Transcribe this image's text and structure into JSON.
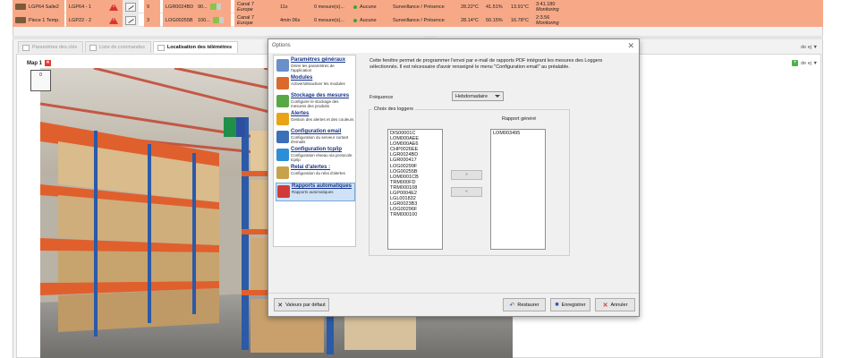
{
  "loggers_table": {
    "rows": [
      {
        "name": "LGP64 Salle2",
        "logger": "LGP64 - 1",
        "count": "9",
        "serial": "LGR0024BD",
        "signal": "90...",
        "channel": "Canal 7",
        "region": "Europe",
        "interval": "11s",
        "measures": "0 mesure(s)...",
        "alarm": "Aucune",
        "mode": "Surveillance / Présence",
        "v1": "28.22°C",
        "v2": "41.51%",
        "v3": "13.91°C",
        "time": "3:41.180",
        "status": "Monitoring"
      },
      {
        "name": "Piece 1 Temp.",
        "logger": "LGP22 - 2",
        "count": "3",
        "serial": "LOG00255B",
        "signal": "100...",
        "channel": "Canal 7",
        "region": "Europe",
        "interval": "4min 06s",
        "measures": "0 mesure(s)...",
        "alarm": "Aucune",
        "mode": "Surveillance / Présence",
        "v1": "28.14°C",
        "v2": "50.15%",
        "v3": "16.78°C",
        "time": "2:3.56",
        "status": "Monitoring"
      }
    ]
  },
  "tabs": [
    {
      "label": "Paramètres des clés",
      "active": false
    },
    {
      "label": "Liste de commandes",
      "active": false
    },
    {
      "label": "Localisation des télémètres",
      "active": true
    }
  ],
  "map": {
    "tab_label": "Map 1",
    "zoom_value": "0"
  },
  "right_controls": {
    "top": "de ej ▼",
    "bottom": "de ej ▼"
  },
  "dialog": {
    "title": "Options",
    "nav": [
      {
        "title": "Paramètres généraux",
        "desc": "Gérer les paramètres de l'application",
        "icon": "magnifier-icon",
        "color": "#6a8fc9"
      },
      {
        "title": "Modules",
        "desc": "Activer/désactiver les modules",
        "icon": "modules-icon",
        "color": "#d96a2b"
      },
      {
        "title": "Stockage des mesures",
        "desc": "Configurer le stockage des mesures des produits",
        "icon": "download-icon",
        "color": "#58a845"
      },
      {
        "title": "Alertes",
        "desc": "Gestion des alertes et des couleurs",
        "icon": "warning-icon",
        "color": "#e8a317"
      },
      {
        "title": "Configuration email",
        "desc": "Configuration du serveur sortant d'emails",
        "icon": "email-icon",
        "color": "#3b6fb6"
      },
      {
        "title": "Configuration tcp/ip",
        "desc": "Configuration réseau via protocole tcp/ip",
        "icon": "network-icon",
        "color": "#2c8ed6"
      },
      {
        "title": "Relai d'alertes :",
        "desc": "Configuration du relai d'alertes",
        "icon": "relay-icon",
        "color": "#c8a24a"
      },
      {
        "title": "Rapports automatiques",
        "desc": "Rapports automatiques",
        "icon": "report-icon",
        "color": "#d23a3a",
        "selected": true
      }
    ],
    "description": "Cette fenêtre permet de programmer l'envoi par e-mail de rapports PDF intégrant les mesures des Loggers sélectionnés. Il est nécessaire d'avoir renseigné le menu \"Configuration email\" au préalable.",
    "frequency_label": "Fréquence",
    "frequency_value": "Hebdomadaire",
    "loggers_group_label": "Choix des loggers",
    "generated_label": "Rapport généré",
    "loggers_list": [
      "DIS00001C",
      "LOM000AEE",
      "LOM000AE6",
      "CHP0026EE",
      "LGR0024BD",
      "LGR000417",
      "LOG00299F",
      "LOG00255B",
      "LOM0001CB",
      "TRM000FD",
      "TRM000108",
      "LGP0004E2",
      "LGL001832",
      "LGR0023B3",
      "LOG00296F",
      "TRM000100"
    ],
    "generated_list": [
      "LOM003495"
    ],
    "move_right": "»",
    "move_left": "«",
    "buttons": {
      "defaults": "Valeurs par défaut",
      "restore": "Restaurer",
      "save": "Enregistrer",
      "cancel": "Annuler"
    }
  }
}
